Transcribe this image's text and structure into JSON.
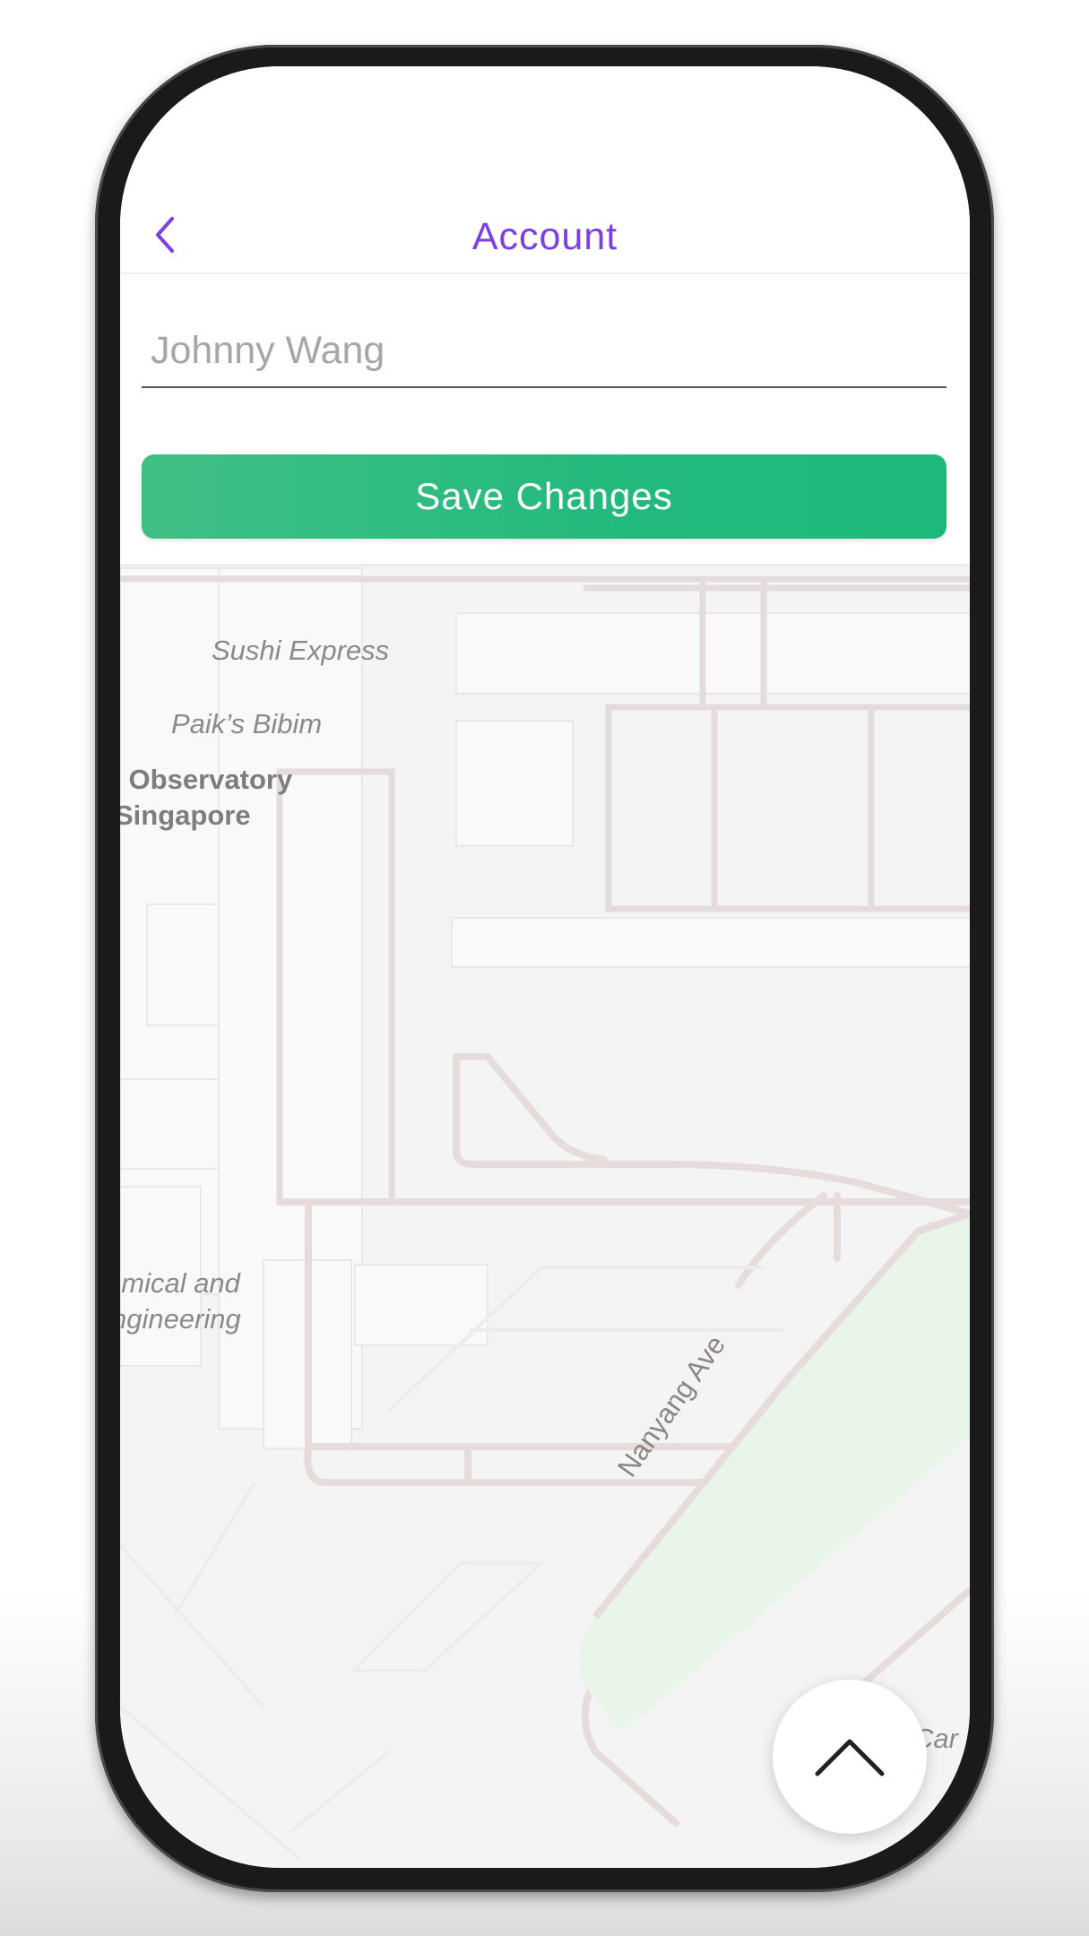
{
  "header": {
    "title": "Account",
    "back_icon": "chevron-left-icon"
  },
  "form": {
    "name_value": "Johnny Wang",
    "save_label": "Save Changes"
  },
  "map": {
    "labels": {
      "sushi_express": "Sushi Express",
      "paiks_bibim": "Paik’s Bibim",
      "observatory_line1": "n Observatory",
      "observatory_line2": "Singapore",
      "chemical_line1": "emical and",
      "chemical_line2": "ngineering",
      "street": "Nanyang Ave",
      "car_park": "Car P"
    }
  },
  "fab": {
    "icon": "chevron-up-icon"
  },
  "colors": {
    "accent": "#7b3fe4",
    "button": "#22ba7c",
    "map_background": "#f4f4f4",
    "park": "#eaf5ea",
    "roads": "#e6dcdc"
  }
}
